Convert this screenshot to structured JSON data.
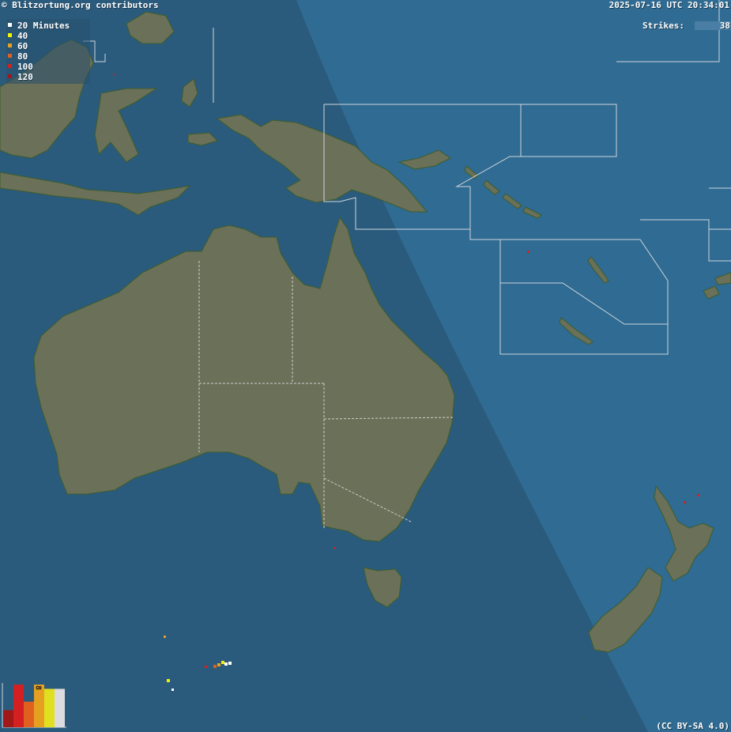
{
  "header": {
    "credit": "© Blitzortung.org contributors",
    "datetime": "2025-07-16 UTC 20:34:01"
  },
  "strikes": {
    "label": "Strikes:",
    "value": "38"
  },
  "legend": {
    "items": [
      {
        "label": "20 Minutes",
        "color": "#ffffff"
      },
      {
        "label": "40",
        "color": "#f2f200"
      },
      {
        "label": "60",
        "color": "#e6a020"
      },
      {
        "label": "80",
        "color": "#e06020"
      },
      {
        "label": "100",
        "color": "#d42020"
      },
      {
        "label": "120",
        "color": "#a01818"
      }
    ]
  },
  "histogram": {
    "label": "8",
    "bars": [
      {
        "value": 4,
        "color": "#a01818"
      },
      {
        "value": 10,
        "color": "#d42020"
      },
      {
        "value": 6,
        "color": "#e06020"
      },
      {
        "value": 10,
        "color": "#e6a020"
      },
      {
        "value": 9,
        "color": "#e0e020"
      },
      {
        "value": 9,
        "color": "#dcdce0"
      }
    ]
  },
  "license": "(CC BY-SA 4.0)",
  "colors": {
    "ocean": "#2f6b92",
    "night_shade": "#2b5a7e",
    "land": "#6b7058",
    "coast": "#3d5d2c",
    "borders": "#d6d6d6"
  }
}
